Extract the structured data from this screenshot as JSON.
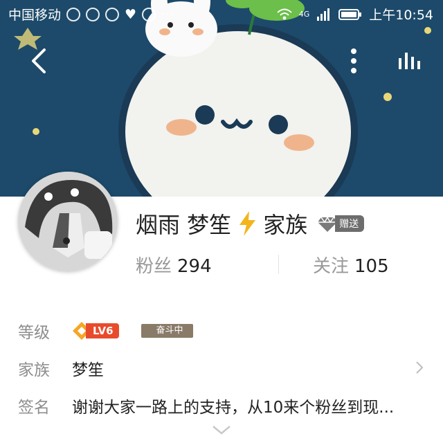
{
  "status_bar": {
    "carrier": "中国移动",
    "network": "4G",
    "time": "上午10:54"
  },
  "profile": {
    "nickname": "烟雨 梦笙",
    "family_suffix": "家族",
    "gift_badge": "赠送",
    "fans_label": "粉丝",
    "fans_count": "294",
    "follow_label": "关注",
    "follow_count": "105"
  },
  "info": {
    "level_label": "等级",
    "level_badge": "LV6",
    "status_badge": "奋斗中",
    "family_label": "家族",
    "family_value": "梦笙",
    "signature_label": "签名",
    "signature_value": "谢谢大家一路上的支持，从10来个粉丝到现..."
  },
  "icons": [
    "back-arrow-icon",
    "more-vertical-icon",
    "stats-bars-icon",
    "lightning-icon",
    "diamond-icon",
    "chevron-right-icon",
    "chevron-down-icon"
  ],
  "colors": {
    "banner": "#1d4a6a",
    "level_badge": "#e84b2c",
    "level_diamond": "#f5a623",
    "status_badge": "#8a7a68",
    "label_gray": "#8d8d8d"
  }
}
